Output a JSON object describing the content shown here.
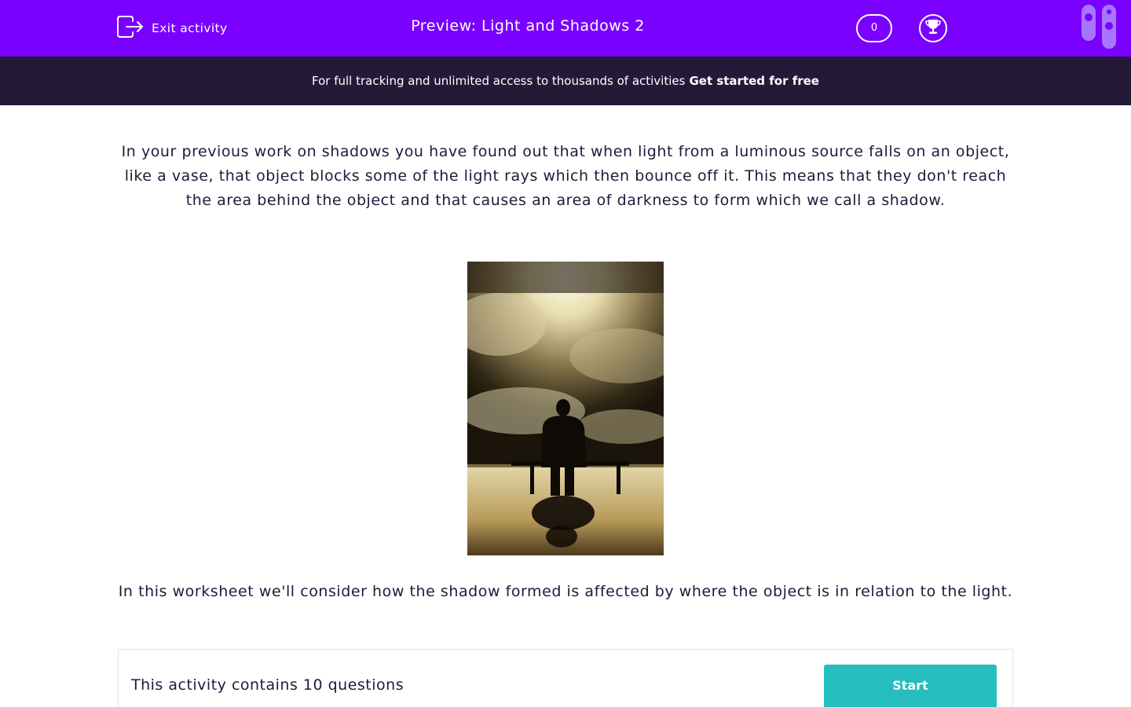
{
  "header": {
    "exit_label": "Exit activity",
    "title": "Preview: Light and Shadows 2",
    "score": "0",
    "exit_icon": "exit-icon",
    "trophy_icon": "trophy-icon",
    "brand_logo": "brand-logo"
  },
  "banner": {
    "text": "For full tracking and unlimited access to thousands of activities",
    "cta": "Get started for free"
  },
  "content": {
    "intro": "In your previous work on shadows you have found out that when light from a luminous source falls on an object, like a vase, that object blocks some of the light rays which then bounce off it. This means that they don't reach the area behind the object and that causes an area of darkness to form which we call a shadow.",
    "image_subject": "silhouette of a person sitting on a bench on a sunny beach",
    "outro": "In this worksheet we'll consider how the shadow formed is affected by where the object is in relation to the light."
  },
  "activity": {
    "summary": "This activity contains 10 questions",
    "start_label": "Start"
  },
  "colors": {
    "topbar": "#7a00ff",
    "banner": "#241a38",
    "start_button": "#25bdbd",
    "text": "#1f1a3a"
  }
}
